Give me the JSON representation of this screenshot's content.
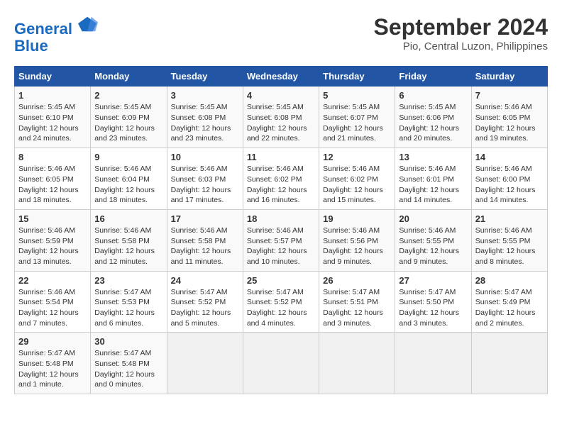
{
  "header": {
    "logo_line1": "General",
    "logo_line2": "Blue",
    "main_title": "September 2024",
    "subtitle": "Pio, Central Luzon, Philippines"
  },
  "calendar": {
    "days_of_week": [
      "Sunday",
      "Monday",
      "Tuesday",
      "Wednesday",
      "Thursday",
      "Friday",
      "Saturday"
    ],
    "weeks": [
      [
        null,
        {
          "day": "2",
          "sunrise": "5:45 AM",
          "sunset": "6:09 PM",
          "daylight": "12 hours and 23 minutes."
        },
        {
          "day": "3",
          "sunrise": "5:45 AM",
          "sunset": "6:08 PM",
          "daylight": "12 hours and 23 minutes."
        },
        {
          "day": "4",
          "sunrise": "5:45 AM",
          "sunset": "6:08 PM",
          "daylight": "12 hours and 22 minutes."
        },
        {
          "day": "5",
          "sunrise": "5:45 AM",
          "sunset": "6:07 PM",
          "daylight": "12 hours and 21 minutes."
        },
        {
          "day": "6",
          "sunrise": "5:45 AM",
          "sunset": "6:06 PM",
          "daylight": "12 hours and 20 minutes."
        },
        {
          "day": "7",
          "sunrise": "5:46 AM",
          "sunset": "6:05 PM",
          "daylight": "12 hours and 19 minutes."
        }
      ],
      [
        {
          "day": "1",
          "sunrise": "5:45 AM",
          "sunset": "6:10 PM",
          "daylight": "12 hours and 24 minutes."
        },
        {
          "day": "9",
          "sunrise": "5:46 AM",
          "sunset": "6:04 PM",
          "daylight": "12 hours and 18 minutes."
        },
        {
          "day": "10",
          "sunrise": "5:46 AM",
          "sunset": "6:03 PM",
          "daylight": "12 hours and 17 minutes."
        },
        {
          "day": "11",
          "sunrise": "5:46 AM",
          "sunset": "6:02 PM",
          "daylight": "12 hours and 16 minutes."
        },
        {
          "day": "12",
          "sunrise": "5:46 AM",
          "sunset": "6:02 PM",
          "daylight": "12 hours and 15 minutes."
        },
        {
          "day": "13",
          "sunrise": "5:46 AM",
          "sunset": "6:01 PM",
          "daylight": "12 hours and 14 minutes."
        },
        {
          "day": "14",
          "sunrise": "5:46 AM",
          "sunset": "6:00 PM",
          "daylight": "12 hours and 14 minutes."
        }
      ],
      [
        {
          "day": "8",
          "sunrise": "5:46 AM",
          "sunset": "6:05 PM",
          "daylight": "12 hours and 18 minutes."
        },
        {
          "day": "16",
          "sunrise": "5:46 AM",
          "sunset": "5:58 PM",
          "daylight": "12 hours and 12 minutes."
        },
        {
          "day": "17",
          "sunrise": "5:46 AM",
          "sunset": "5:58 PM",
          "daylight": "12 hours and 11 minutes."
        },
        {
          "day": "18",
          "sunrise": "5:46 AM",
          "sunset": "5:57 PM",
          "daylight": "12 hours and 10 minutes."
        },
        {
          "day": "19",
          "sunrise": "5:46 AM",
          "sunset": "5:56 PM",
          "daylight": "12 hours and 9 minutes."
        },
        {
          "day": "20",
          "sunrise": "5:46 AM",
          "sunset": "5:55 PM",
          "daylight": "12 hours and 9 minutes."
        },
        {
          "day": "21",
          "sunrise": "5:46 AM",
          "sunset": "5:55 PM",
          "daylight": "12 hours and 8 minutes."
        }
      ],
      [
        {
          "day": "15",
          "sunrise": "5:46 AM",
          "sunset": "5:59 PM",
          "daylight": "12 hours and 13 minutes."
        },
        {
          "day": "23",
          "sunrise": "5:47 AM",
          "sunset": "5:53 PM",
          "daylight": "12 hours and 6 minutes."
        },
        {
          "day": "24",
          "sunrise": "5:47 AM",
          "sunset": "5:52 PM",
          "daylight": "12 hours and 5 minutes."
        },
        {
          "day": "25",
          "sunrise": "5:47 AM",
          "sunset": "5:52 PM",
          "daylight": "12 hours and 4 minutes."
        },
        {
          "day": "26",
          "sunrise": "5:47 AM",
          "sunset": "5:51 PM",
          "daylight": "12 hours and 3 minutes."
        },
        {
          "day": "27",
          "sunrise": "5:47 AM",
          "sunset": "5:50 PM",
          "daylight": "12 hours and 3 minutes."
        },
        {
          "day": "28",
          "sunrise": "5:47 AM",
          "sunset": "5:49 PM",
          "daylight": "12 hours and 2 minutes."
        }
      ],
      [
        {
          "day": "22",
          "sunrise": "5:46 AM",
          "sunset": "5:54 PM",
          "daylight": "12 hours and 7 minutes."
        },
        {
          "day": "30",
          "sunrise": "5:47 AM",
          "sunset": "5:48 PM",
          "daylight": "12 hours and 0 minutes."
        },
        null,
        null,
        null,
        null,
        null
      ],
      [
        {
          "day": "29",
          "sunrise": "5:47 AM",
          "sunset": "5:48 PM",
          "daylight": "12 hours and 1 minute."
        },
        null,
        null,
        null,
        null,
        null,
        null
      ]
    ]
  }
}
